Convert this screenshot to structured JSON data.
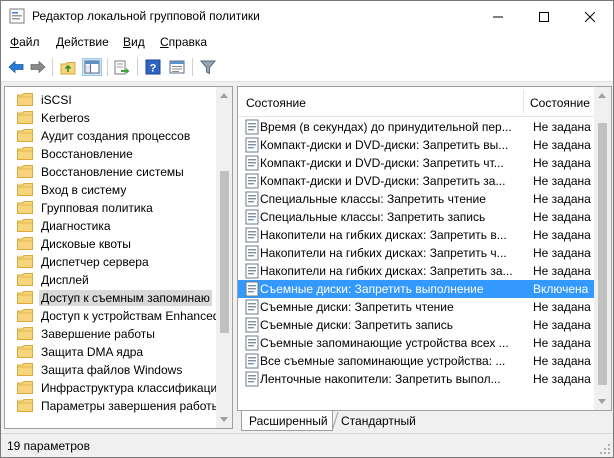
{
  "window": {
    "title": "Редактор локальной групповой политики"
  },
  "menu": [
    {
      "label": "Файл",
      "accel": "Ф",
      "rest": "айл"
    },
    {
      "label": "Действие",
      "accel": "Д",
      "rest": "ействие"
    },
    {
      "label": "Вид",
      "accel": "В",
      "rest": "ид"
    },
    {
      "label": "Справка",
      "accel": "С",
      "rest": "правка"
    }
  ],
  "toolbar": {
    "icons": [
      "back-arrow-icon",
      "forward-arrow-icon",
      "up-folder-icon",
      "show-hide-tree-icon",
      "export-list-icon",
      "help-icon",
      "properties-icon",
      "filter-icon"
    ]
  },
  "tree": {
    "items": [
      {
        "label": "iSCSI"
      },
      {
        "label": "Kerberos"
      },
      {
        "label": "Аудит создания процессов"
      },
      {
        "label": "Восстановление"
      },
      {
        "label": "Восстановление системы"
      },
      {
        "label": "Вход в систему"
      },
      {
        "label": "Групповая политика"
      },
      {
        "label": "Диагностика"
      },
      {
        "label": "Дисковые квоты"
      },
      {
        "label": "Диспетчер сервера"
      },
      {
        "label": "Дисплей"
      },
      {
        "label": "Доступ к съемным запоминаю",
        "selected": true
      },
      {
        "label": "Доступ к устройствам Enhanced"
      },
      {
        "label": "Завершение работы"
      },
      {
        "label": "Защита DMA ядра"
      },
      {
        "label": "Защита файлов Windows"
      },
      {
        "label": "Инфраструктура классификации"
      },
      {
        "label": "Параметры завершения работы"
      }
    ]
  },
  "list": {
    "columns": {
      "setting": "Состояние",
      "state": "Состояние"
    },
    "rows": [
      {
        "name": "Время (в секундах) до принудительной пер...",
        "state": "Не задана"
      },
      {
        "name": "Компакт-диски и DVD-диски: Запретить вы...",
        "state": "Не задана"
      },
      {
        "name": "Компакт-диски и DVD-диски: Запретить чт...",
        "state": "Не задана"
      },
      {
        "name": "Компакт-диски и DVD-диски: Запретить за...",
        "state": "Не задана"
      },
      {
        "name": "Специальные классы: Запретить чтение",
        "state": "Не задана"
      },
      {
        "name": "Специальные классы: Запретить запись",
        "state": "Не задана"
      },
      {
        "name": "Накопители на гибких дисках: Запретить в...",
        "state": "Не задана"
      },
      {
        "name": "Накопители на гибких дисках: Запретить ч...",
        "state": "Не задана"
      },
      {
        "name": "Накопители на гибких дисках: Запретить за...",
        "state": "Не задана"
      },
      {
        "name": "Съемные диски: Запретить выполнение",
        "state": "Включена",
        "selected": true
      },
      {
        "name": "Съемные диски: Запретить чтение",
        "state": "Не задана"
      },
      {
        "name": "Съемные диски: Запретить запись",
        "state": "Не задана"
      },
      {
        "name": "Съемные запоминающие устройства всех ...",
        "state": "Не задана"
      },
      {
        "name": "Все съемные запоминающие устройства: ...",
        "state": "Не задана"
      },
      {
        "name": "Ленточные накопители: Запретить выпол...",
        "state": "Не задана"
      }
    ]
  },
  "tabs": [
    {
      "label": "Расширенный",
      "active": true
    },
    {
      "label": "Стандартный",
      "active": false
    }
  ],
  "status": {
    "text": "19 параметров"
  },
  "colors": {
    "selection": "#3399ff",
    "folder": "#f6d47a",
    "folder_edge": "#d9a93b"
  }
}
